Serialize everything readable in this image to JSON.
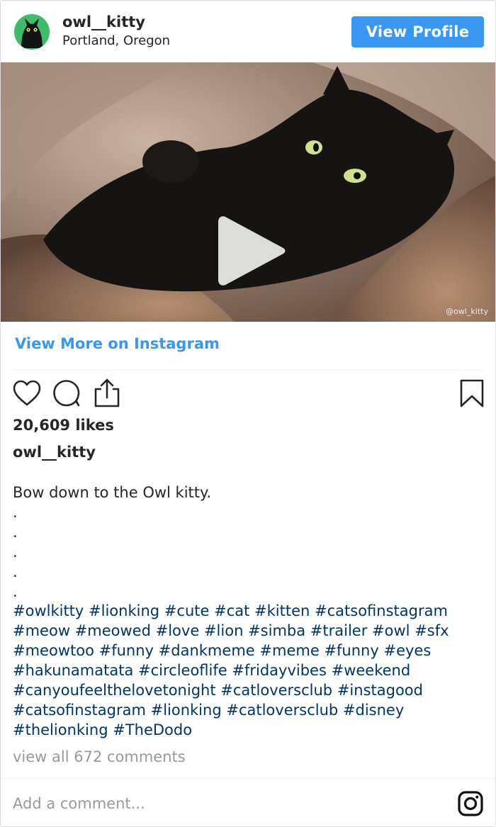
{
  "header": {
    "username": "owl__kitty",
    "location": "Portland, Oregon",
    "view_profile_label": "View Profile"
  },
  "media": {
    "watermark": "@owl_kitty"
  },
  "view_more_label": "View More on Instagram",
  "actions": {
    "like_icon": "heart-icon",
    "comment_icon": "comment-icon",
    "share_icon": "share-icon",
    "save_icon": "bookmark-icon"
  },
  "likes_text": "20,609 likes",
  "caption": {
    "username": "owl__kitty",
    "lines": [
      "Bow down to the Owl kitty.",
      ".",
      ".",
      ".",
      ".",
      "."
    ]
  },
  "hashtag_lines": [
    [
      "#owlkitty",
      "#lionking",
      "#cute",
      "#cat",
      "#kitten",
      "#catsofinstagram"
    ],
    [
      "#meow",
      "#meowed",
      "#love",
      "#lion",
      "#simba",
      "#trailer",
      "#owl",
      "#sfx"
    ],
    [
      "#meowtoo",
      "#funny",
      "#dankmeme",
      "#meme",
      "#funny",
      "#eyes"
    ],
    [
      "#hakunamatata",
      "#circleoflife",
      "#fridayvibes",
      "#weekend"
    ],
    [
      "#canyoufeelthelovetonight",
      "#catloversclub",
      "#instagood"
    ],
    [
      "#catsofinstagram",
      "#lionking",
      "#catloversclub",
      "#disney"
    ],
    [
      "#thelionking",
      "#TheDodo"
    ]
  ],
  "view_comments_label": "view all 672 comments",
  "comment_placeholder": "Add a comment...",
  "colors": {
    "accent": "#3897f0",
    "hashtag": "#003569",
    "muted": "#999999"
  }
}
